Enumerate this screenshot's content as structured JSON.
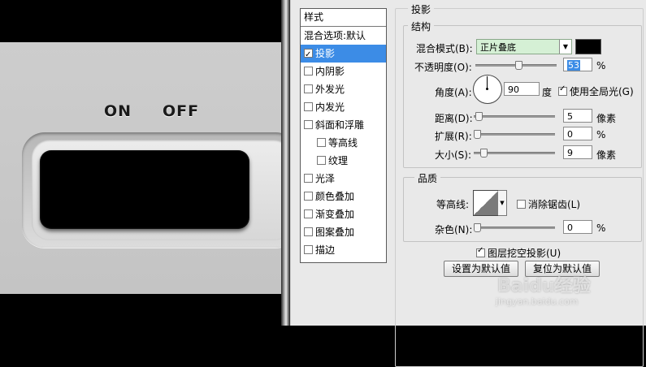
{
  "canvas": {
    "on_label": "ON",
    "off_label": "OFF"
  },
  "styles": {
    "header": "样式",
    "items": [
      {
        "label": "混合选项:默认",
        "checkbox": false,
        "checked": false,
        "selected": false,
        "indent": false
      },
      {
        "label": "投影",
        "checkbox": true,
        "checked": true,
        "selected": true,
        "indent": false
      },
      {
        "label": "内阴影",
        "checkbox": true,
        "checked": false,
        "selected": false,
        "indent": false
      },
      {
        "label": "外发光",
        "checkbox": true,
        "checked": false,
        "selected": false,
        "indent": false
      },
      {
        "label": "内发光",
        "checkbox": true,
        "checked": false,
        "selected": false,
        "indent": false
      },
      {
        "label": "斜面和浮雕",
        "checkbox": true,
        "checked": false,
        "selected": false,
        "indent": false
      },
      {
        "label": "等高线",
        "checkbox": true,
        "checked": false,
        "selected": false,
        "indent": true
      },
      {
        "label": "纹理",
        "checkbox": true,
        "checked": false,
        "selected": false,
        "indent": true
      },
      {
        "label": "光泽",
        "checkbox": true,
        "checked": false,
        "selected": false,
        "indent": false
      },
      {
        "label": "颜色叠加",
        "checkbox": true,
        "checked": false,
        "selected": false,
        "indent": false
      },
      {
        "label": "渐变叠加",
        "checkbox": true,
        "checked": false,
        "selected": false,
        "indent": false
      },
      {
        "label": "图案叠加",
        "checkbox": true,
        "checked": false,
        "selected": false,
        "indent": false
      },
      {
        "label": "描边",
        "checkbox": true,
        "checked": false,
        "selected": false,
        "indent": false
      }
    ]
  },
  "shadow": {
    "title": "投影",
    "structure": {
      "title": "结构",
      "blend_mode_label": "混合模式(B):",
      "blend_mode_value": "正片叠底",
      "blend_color": "#000000",
      "opacity_label": "不透明度(O):",
      "opacity_value": "53",
      "opacity_unit": "%",
      "angle_label": "角度(A):",
      "angle_value": "90",
      "angle_unit": "度",
      "global_light_label": "使用全局光(G)",
      "global_light_checked": true,
      "distance_label": "距离(D):",
      "distance_value": "5",
      "distance_unit": "像素",
      "spread_label": "扩展(R):",
      "spread_value": "0",
      "spread_unit": "%",
      "size_label": "大小(S):",
      "size_value": "9",
      "size_unit": "像素"
    },
    "quality": {
      "title": "品质",
      "contour_label": "等高线:",
      "antialias_label": "消除锯齿(L)",
      "antialias_checked": false,
      "noise_label": "杂色(N):",
      "noise_value": "0",
      "noise_unit": "%"
    },
    "knockout_label": "图层挖空投影(U)",
    "knockout_checked": true,
    "set_default_button": "设置为默认值",
    "reset_default_button": "复位为默认值"
  },
  "watermark": {
    "logo": "Baidu经验",
    "url": "jingyan.baidu.com"
  }
}
